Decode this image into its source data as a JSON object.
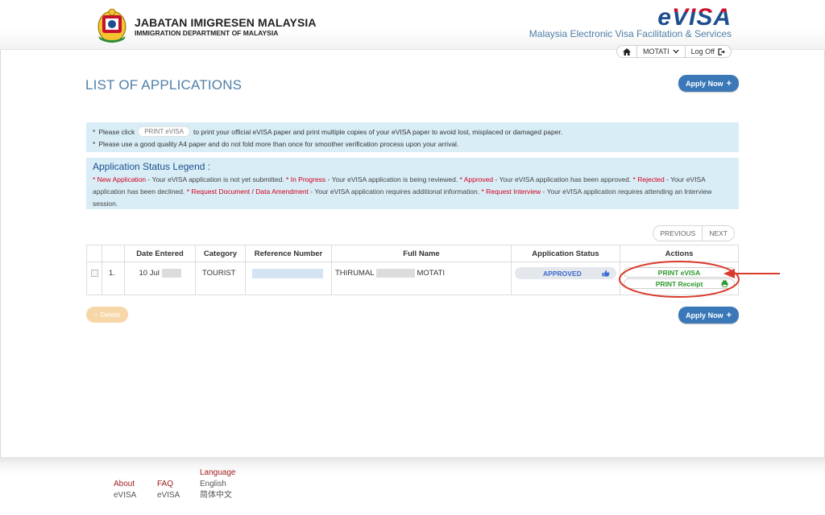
{
  "header": {
    "agency_name": "JABATAN IMIGRESEN MALAYSIA",
    "agency_name_en": "IMMIGRATION DEPARTMENT OF MALAYSIA",
    "logo_text_e": "e",
    "logo_text_visa": "VISA",
    "tagline": "Malaysia Electronic Visa Facilitation & Services",
    "nav": {
      "home_icon": "home-icon",
      "user_label": "MOTATI",
      "logoff_label": "Log Off"
    }
  },
  "main": {
    "page_title": "LIST OF APPLICATIONS",
    "apply_now_label": "Apply Now",
    "info": {
      "line1_prefix": "Please click",
      "line1_pill": "PRINT eVISA",
      "line1_suffix": "to print your official eVISA paper and print multiple copies of your eVISA paper to avoid lost, misplaced or damaged paper.",
      "line2": "Please use a good quality A4 paper and do not fold more than once for smoother verification process upon your arrival."
    },
    "legend": {
      "title": "Application Status Legend :",
      "new_label": "* New Application",
      "new_desc": " - Your eVISA application is not yet submitted. ",
      "progress_label": "* In Progress",
      "progress_desc": " - Your eVISA application is being reviewed. ",
      "approved_label": "* Approved",
      "approved_desc": " - Your eVISA application has been approved. ",
      "rejected_label": "* Rejected",
      "rejected_desc": " - Your eVISA application has been declined. ",
      "request_doc_label": "* Request Document / Data Amendment",
      "request_doc_desc": " - Your eVISA application requires additional information. ",
      "request_int_label": "* Request Interview",
      "request_int_desc": "  - Your eVISA application requires attending an Interview session."
    },
    "pager": {
      "previous": "PREVIOUS",
      "next": "NEXT"
    },
    "table": {
      "headers": [
        "",
        "",
        "Date Entered",
        "Category",
        "Reference Number",
        "Full Name",
        "Application Status",
        "Actions"
      ],
      "rows": [
        {
          "num": "1.",
          "date": "10 Jul",
          "category": "TOURIST",
          "name_first": "THIRUMAL",
          "name_last": "MOTATI",
          "status": "APPROVED",
          "print_evisa": "PRINT eVISA",
          "print_receipt": "PRINT Receipt"
        }
      ]
    },
    "delete_label": "Delete"
  },
  "footer": {
    "about": "About",
    "about_sub": "eVISA",
    "faq": "FAQ",
    "faq_sub": "eVISA",
    "language": "Language",
    "lang_en": "English",
    "lang_zh": "简体中文"
  },
  "colors": {
    "accent_blue": "#3a78b8",
    "title_blue": "#4f7fa8",
    "info_bg": "#d9edf7",
    "legend_red": "#d0021b",
    "approved_blue": "#3b6bd1",
    "action_green": "#2e9a2e",
    "annotation_red": "#d93a2b"
  }
}
